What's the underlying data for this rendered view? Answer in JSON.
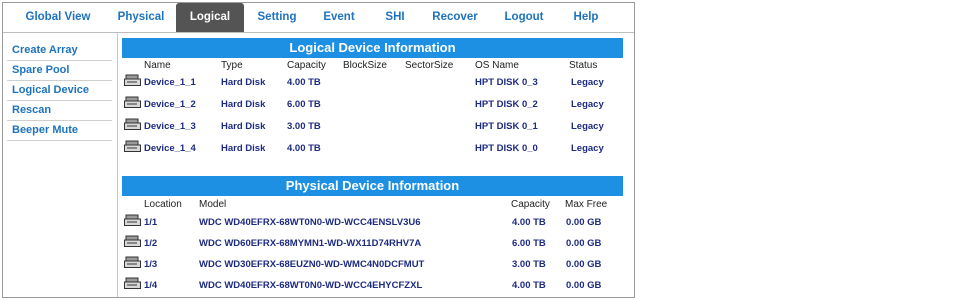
{
  "nav": {
    "tabs": [
      {
        "label": "Global View",
        "active": false
      },
      {
        "label": "Physical",
        "active": false
      },
      {
        "label": "Logical",
        "active": true
      },
      {
        "label": "Setting",
        "active": false
      },
      {
        "label": "Event",
        "active": false
      },
      {
        "label": "SHI",
        "active": false
      },
      {
        "label": "Recover",
        "active": false
      },
      {
        "label": "Logout",
        "active": false
      },
      {
        "label": "Help",
        "active": false
      }
    ]
  },
  "sidebar": {
    "items": [
      "Create Array",
      "Spare Pool",
      "Logical Device",
      "Rescan",
      "Beeper Mute"
    ]
  },
  "logical": {
    "title": "Logical Device Information",
    "headers": [
      "Name",
      "Type",
      "Capacity",
      "BlockSize",
      "SectorSize",
      "OS Name",
      "Status"
    ],
    "rows": [
      {
        "name": "Device_1_1",
        "type": "Hard Disk",
        "capacity": "4.00 TB",
        "blocksize": "",
        "sectorsize": "",
        "osname": "HPT DISK 0_3",
        "status": "Legacy"
      },
      {
        "name": "Device_1_2",
        "type": "Hard Disk",
        "capacity": "6.00 TB",
        "blocksize": "",
        "sectorsize": "",
        "osname": "HPT DISK 0_2",
        "status": "Legacy"
      },
      {
        "name": "Device_1_3",
        "type": "Hard Disk",
        "capacity": "3.00 TB",
        "blocksize": "",
        "sectorsize": "",
        "osname": "HPT DISK 0_1",
        "status": "Legacy"
      },
      {
        "name": "Device_1_4",
        "type": "Hard Disk",
        "capacity": "4.00 TB",
        "blocksize": "",
        "sectorsize": "",
        "osname": "HPT DISK 0_0",
        "status": "Legacy"
      }
    ]
  },
  "physical": {
    "title": "Physical Device Information",
    "headers": [
      "Location",
      "Model",
      "Capacity",
      "Max Free"
    ],
    "rows": [
      {
        "location": "1/1",
        "model": "WDC WD40EFRX-68WT0N0-WD-WCC4ENSLV3U6",
        "capacity": "4.00 TB",
        "maxfree": "0.00 GB"
      },
      {
        "location": "1/2",
        "model": "WDC WD60EFRX-68MYMN1-WD-WX11D74RHV7A",
        "capacity": "6.00 TB",
        "maxfree": "0.00 GB"
      },
      {
        "location": "1/3",
        "model": "WDC WD30EFRX-68EUZN0-WD-WMC4N0DCFMUT",
        "capacity": "3.00 TB",
        "maxfree": "0.00 GB"
      },
      {
        "location": "1/4",
        "model": "WDC WD40EFRX-68WT0N0-WD-WCC4EHYCFZXL",
        "capacity": "4.00 TB",
        "maxfree": "0.00 GB"
      }
    ]
  },
  "colors": {
    "accent": "#1e90e4",
    "link": "#1e73be",
    "cell_text": "#1d2b80",
    "active_tab": "#545454"
  }
}
